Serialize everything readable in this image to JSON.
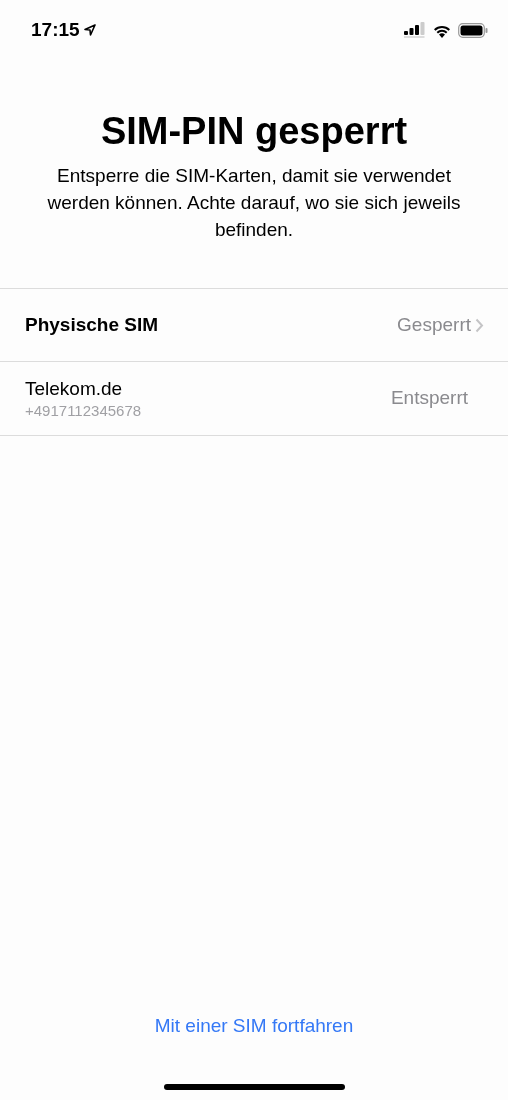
{
  "status_bar": {
    "time": "17:15"
  },
  "title": "SIM-PIN gesperrt",
  "description": "Entsperre die SIM-Karten, damit sie verwendet werden können. Achte darauf, wo sie sich jeweils befinden.",
  "sims": [
    {
      "kind": "physical",
      "name": "Physische SIM",
      "status": "Gesperrt"
    },
    {
      "kind": "line",
      "name": "Telekom.de",
      "number": "+4917112345678",
      "status": "Entsperrt"
    }
  ],
  "link": "Mit einer SIM fortfahren"
}
